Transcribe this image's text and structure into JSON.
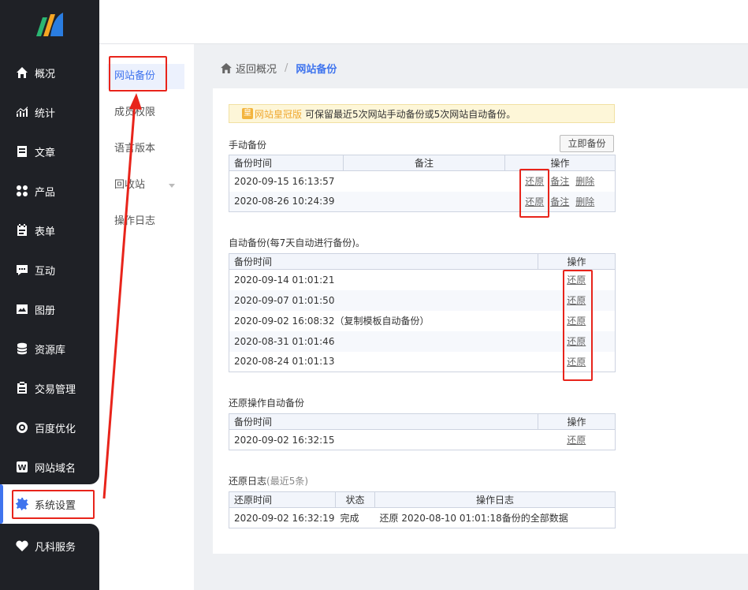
{
  "nav": {
    "items": [
      {
        "label": "概况",
        "icon": "home-icon"
      },
      {
        "label": "统计",
        "icon": "stats-icon"
      },
      {
        "label": "文章",
        "icon": "article-icon"
      },
      {
        "label": "产品",
        "icon": "product-icon"
      },
      {
        "label": "表单",
        "icon": "form-icon"
      },
      {
        "label": "互动",
        "icon": "chat-icon"
      },
      {
        "label": "图册",
        "icon": "gallery-icon"
      },
      {
        "label": "资源库",
        "icon": "database-icon"
      },
      {
        "label": "交易管理",
        "icon": "trade-icon"
      },
      {
        "label": "百度优化",
        "icon": "seo-icon"
      },
      {
        "label": "网站域名",
        "icon": "domain-icon"
      },
      {
        "label": "系统设置",
        "icon": "gear-icon"
      },
      {
        "label": "凡科服务",
        "icon": "heart-icon"
      }
    ]
  },
  "subnav": {
    "items": [
      "网站备份",
      "成员权限",
      "语言版本",
      "回收站",
      "操作日志"
    ]
  },
  "breadcrumb": {
    "back": "返回概况",
    "separator": "/",
    "current": "网站备份"
  },
  "notice": {
    "badge": "皇",
    "edition": "网站皇冠版",
    "text": "可保留最近5次网站手动备份或5次网站自动备份。"
  },
  "manual": {
    "title": "手动备份",
    "button": "立即备份",
    "headers": [
      "备份时间",
      "备注",
      "操作"
    ],
    "rows": [
      {
        "time": "2020-09-15 16:13:57",
        "note": ""
      },
      {
        "time": "2020-08-26 10:24:39",
        "note": ""
      }
    ],
    "ops": [
      "还原",
      "备注",
      "删除"
    ]
  },
  "auto": {
    "title": "自动备份(每7天自动进行备份)。",
    "headers": [
      "备份时间",
      "操作"
    ],
    "rows": [
      "2020-09-14 01:01:21",
      "2020-09-07 01:01:50",
      "2020-09-02 16:08:32（复制模板自动备份）",
      "2020-08-31 01:01:46",
      "2020-08-24 01:01:13"
    ],
    "op": "还原"
  },
  "restore_auto": {
    "title": "还原操作自动备份",
    "headers": [
      "备份时间",
      "操作"
    ],
    "rows": [
      "2020-09-02 16:32:15"
    ],
    "op": "还原"
  },
  "restore_log": {
    "title": "还原日志",
    "title_suffix": "(最近5条)",
    "headers": [
      "还原时间",
      "状态",
      "操作日志"
    ],
    "rows": [
      {
        "time": "2020-09-02 16:32:19",
        "status": "完成",
        "log": "还原 2020-08-10 01:01:18备份的全部数据"
      }
    ]
  },
  "colors": {
    "accent": "#3f74ee",
    "annotation": "#e8241b",
    "nav_bg": "#1f2126"
  }
}
